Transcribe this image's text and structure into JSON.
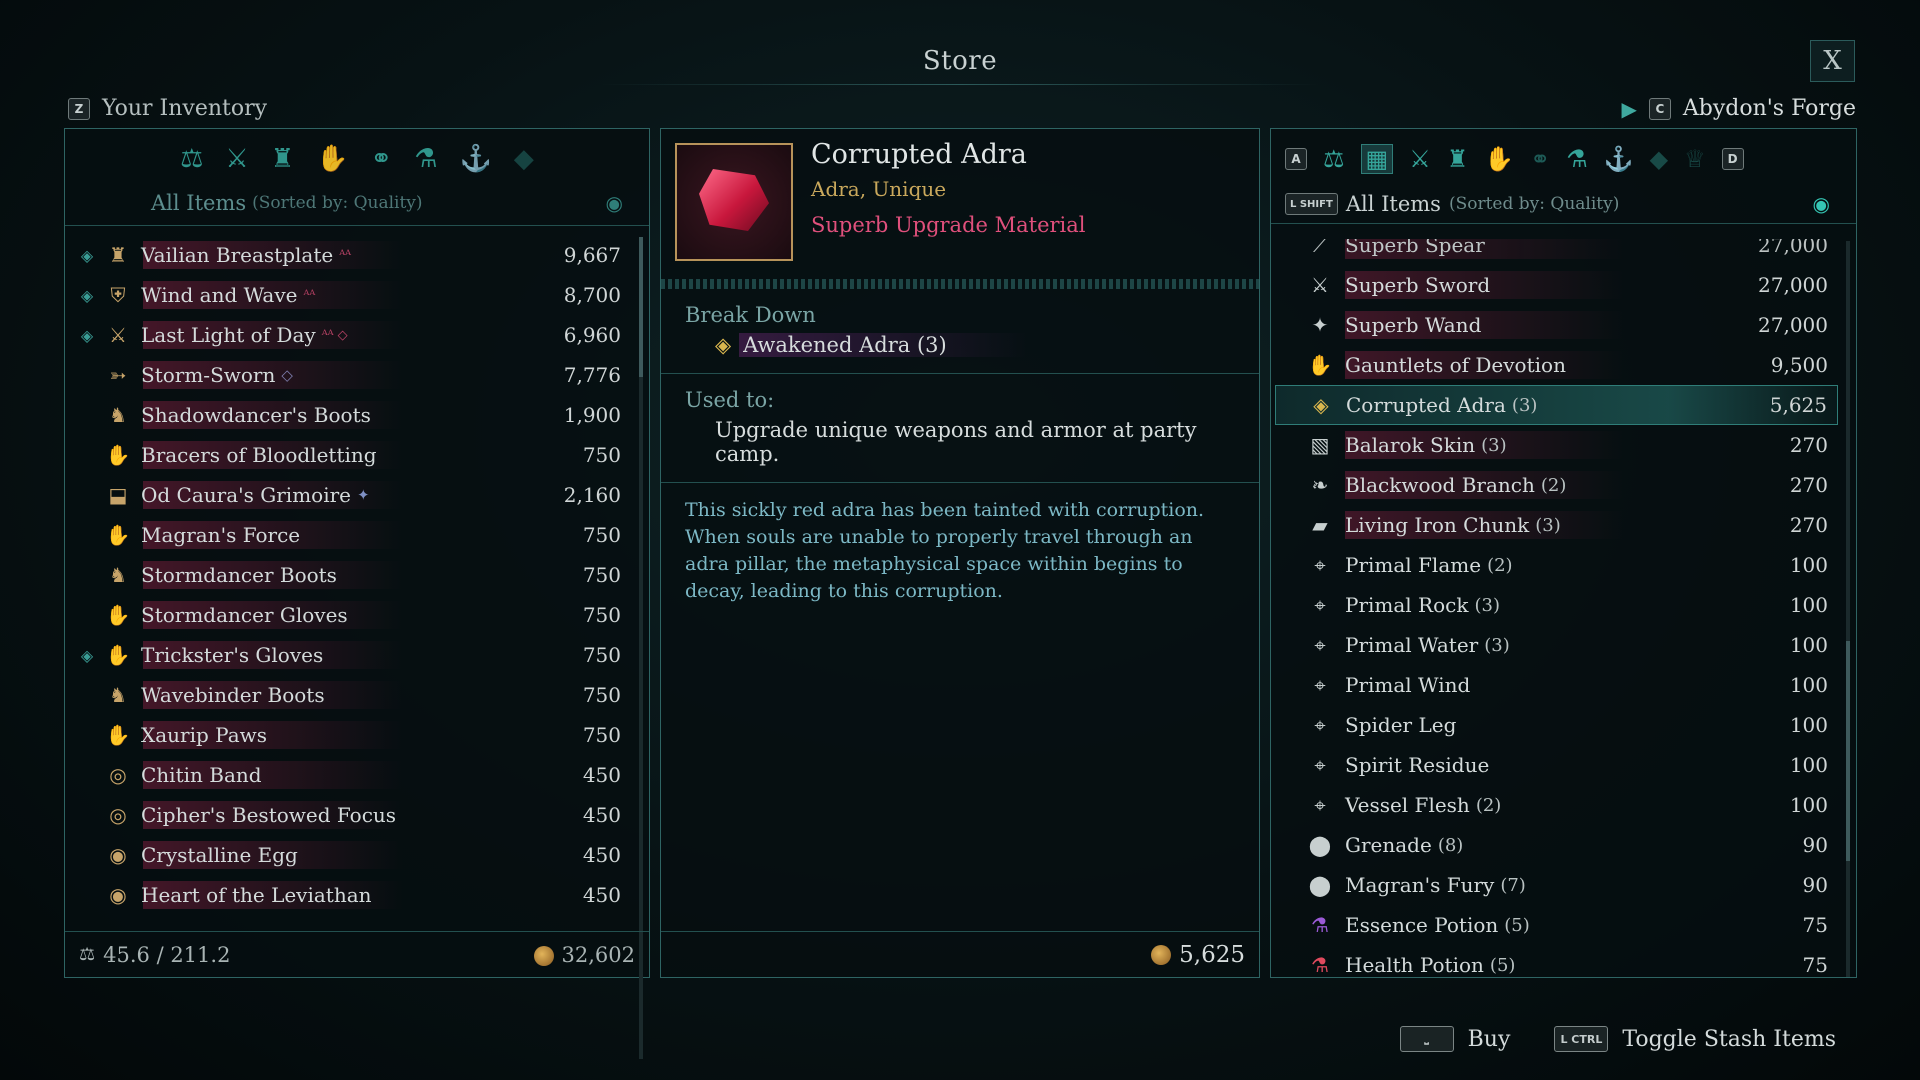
{
  "store": {
    "title": "Store",
    "close_label": "X"
  },
  "inventory": {
    "key": "Z",
    "title": "Your Inventory",
    "filter_label": "All Items",
    "sorted_label": "(Sorted by: Quality)",
    "weight": "45.6 / 211.2",
    "money": "32,602",
    "items": [
      {
        "name": "Vailian Breastplate",
        "tag": "ᴬᴬ",
        "price": "9,667",
        "diamond": true,
        "icon": "breastplate-icon"
      },
      {
        "name": "Wind and Wave",
        "tag": "ᴬᴬ",
        "price": "8,700",
        "diamond": true,
        "icon": "shield-icon"
      },
      {
        "name": "Last Light of Day",
        "tag": "ᴬᴬ ◇",
        "price": "6,960",
        "diamond": true,
        "icon": "sword-icon"
      },
      {
        "name": "Storm-Sworn",
        "tag": "◇",
        "price": "7,776",
        "diamond": false,
        "icon": "bow-icon"
      },
      {
        "name": "Shadowdancer's Boots",
        "tag": "",
        "price": "1,900",
        "diamond": false,
        "icon": "boots-icon"
      },
      {
        "name": "Bracers of Bloodletting",
        "tag": "",
        "price": "750",
        "diamond": false,
        "icon": "gloves-icon"
      },
      {
        "name": "Od Caura's Grimoire",
        "tag": "✦",
        "price": "2,160",
        "diamond": false,
        "icon": "grimoire-icon"
      },
      {
        "name": "Magran's Force",
        "tag": "",
        "price": "750",
        "diamond": false,
        "icon": "gloves-icon"
      },
      {
        "name": "Stormdancer Boots",
        "tag": "",
        "price": "750",
        "diamond": false,
        "icon": "boots-icon"
      },
      {
        "name": "Stormdancer Gloves",
        "tag": "",
        "price": "750",
        "diamond": false,
        "icon": "gloves-icon"
      },
      {
        "name": "Trickster's Gloves",
        "tag": "",
        "price": "750",
        "diamond": true,
        "icon": "gloves-icon"
      },
      {
        "name": "Wavebinder Boots",
        "tag": "",
        "price": "750",
        "diamond": false,
        "icon": "boots-icon"
      },
      {
        "name": "Xaurip Paws",
        "tag": "",
        "price": "750",
        "diamond": false,
        "icon": "gloves-icon"
      },
      {
        "name": "Chitin Band",
        "tag": "",
        "price": "450",
        "diamond": false,
        "icon": "ring-icon"
      },
      {
        "name": "Cipher's Bestowed Focus",
        "tag": "",
        "price": "450",
        "diamond": false,
        "icon": "ring-icon"
      },
      {
        "name": "Crystalline Egg",
        "tag": "",
        "price": "450",
        "diamond": false,
        "icon": "amulet-icon"
      },
      {
        "name": "Heart of the Leviathan",
        "tag": "",
        "price": "450",
        "diamond": false,
        "icon": "amulet-icon"
      }
    ]
  },
  "detail": {
    "name": "Corrupted Adra",
    "subtitle": "Adra, Unique",
    "quality": "Superb Upgrade Material",
    "breakdown_label": "Break Down",
    "breakdown_value": "Awakened Adra (3)",
    "used_label": "Used to:",
    "used_value": "Upgrade unique weapons and armor at party camp.",
    "flavor": "This sickly red adra has been tainted with corruption. When souls are unable to properly travel through an adra pillar, the metaphysical space within begins to decay, leading to this corruption.",
    "price": "5,625"
  },
  "vendor": {
    "key": "C",
    "title": "Abydon's Forge",
    "cat_left_key": "A",
    "cat_right_key": "D",
    "filter_key": "L SHIFT",
    "filter_label": "All Items",
    "sorted_label": "(Sorted by: Quality)",
    "cut_item": {
      "name": "Superb Spear",
      "price": "27,000"
    },
    "items": [
      {
        "name": "Superb Sword",
        "qty": "",
        "price": "27,000",
        "icon": "sword-icon",
        "bar": true
      },
      {
        "name": "Superb Wand",
        "qty": "",
        "price": "27,000",
        "icon": "wand-icon",
        "bar": true
      },
      {
        "name": "Gauntlets of Devotion",
        "qty": "",
        "price": "9,500",
        "icon": "gloves-icon",
        "bar": true
      },
      {
        "name": "Corrupted Adra",
        "qty": "(3)",
        "price": "5,625",
        "icon": "adra-icon",
        "bar": false,
        "selected": true
      },
      {
        "name": "Balarok Skin",
        "qty": "(3)",
        "price": "270",
        "icon": "skin-icon",
        "bar": true
      },
      {
        "name": "Blackwood Branch",
        "qty": "(2)",
        "price": "270",
        "icon": "branch-icon",
        "bar": true
      },
      {
        "name": "Living Iron Chunk",
        "qty": "(3)",
        "price": "270",
        "icon": "iron-icon",
        "bar": true
      },
      {
        "name": "Primal Flame",
        "qty": "(2)",
        "price": "100",
        "icon": "scroll-icon",
        "bar": false
      },
      {
        "name": "Primal Rock",
        "qty": "(3)",
        "price": "100",
        "icon": "scroll-icon",
        "bar": false
      },
      {
        "name": "Primal Water",
        "qty": "(3)",
        "price": "100",
        "icon": "scroll-icon",
        "bar": false
      },
      {
        "name": "Primal Wind",
        "qty": "",
        "price": "100",
        "icon": "scroll-icon",
        "bar": false
      },
      {
        "name": "Spider Leg",
        "qty": "",
        "price": "100",
        "icon": "scroll-icon",
        "bar": false
      },
      {
        "name": "Spirit Residue",
        "qty": "",
        "price": "100",
        "icon": "scroll-icon",
        "bar": false
      },
      {
        "name": "Vessel Flesh",
        "qty": "(2)",
        "price": "100",
        "icon": "scroll-icon",
        "bar": false
      },
      {
        "name": "Grenade",
        "qty": "(8)",
        "price": "90",
        "icon": "grenade-icon",
        "bar": false
      },
      {
        "name": "Magran's Fury",
        "qty": "(7)",
        "price": "90",
        "icon": "grenade-icon",
        "bar": false
      },
      {
        "name": "Essence Potion",
        "qty": "(5)",
        "price": "75",
        "icon": "potion-icon",
        "bar": false
      },
      {
        "name": "Health Potion",
        "qty": "(5)",
        "price": "75",
        "icon": "potion-icon",
        "bar": false
      }
    ]
  },
  "hints": {
    "buy_key": "",
    "buy_label": "Buy",
    "toggle_key": "L CTRL",
    "toggle_label": "Toggle Stash Items"
  }
}
